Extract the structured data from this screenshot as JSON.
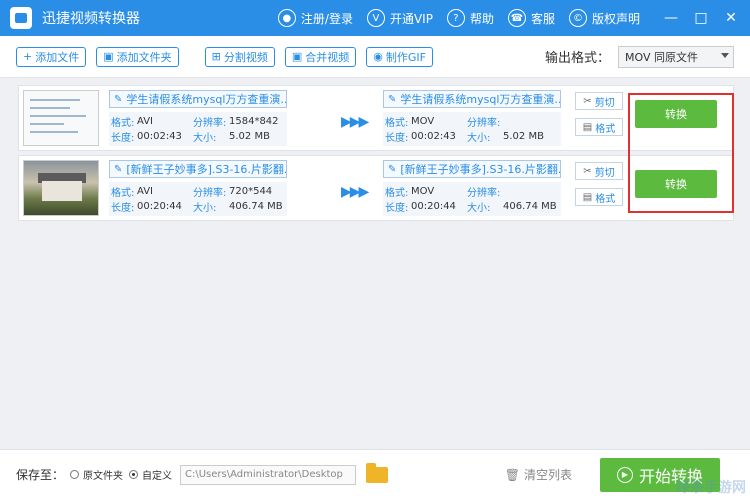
{
  "window": {
    "title": "迅捷视频转换器",
    "register_label": "注册/登录",
    "vip_label": "开通VIP",
    "help_label": "帮助",
    "service_label": "客服",
    "copyright_label": "版权声明"
  },
  "toolbar": {
    "add_file": "添加文件",
    "add_folder": "添加文件夹",
    "split_video": "分割视频",
    "merge_video": "合并视频",
    "make_gif": "制作GIF",
    "output_format_label": "输出格式：",
    "output_format_value": "MOV  同原文件"
  },
  "meta_labels": {
    "format": "格式:",
    "resolution": "分辨率:",
    "duration": "长度:",
    "size": "大小:"
  },
  "files": [
    {
      "src": {
        "name": "学生请假系统mysql万方查重演...",
        "format": "AVI",
        "resolution": "1584*842",
        "duration": "00:02:43",
        "size": "5.02 MB"
      },
      "dst": {
        "name": "学生请假系统mysql万方查重演...",
        "format": "MOV",
        "resolution": "",
        "duration": "00:02:43",
        "size": "5.02 MB"
      },
      "cut_label": "剪切",
      "format_label": "格式",
      "convert_label": "转换"
    },
    {
      "src": {
        "name": "[新鲜王子妙事多].S3-16.片影翻...",
        "format": "AVI",
        "resolution": "720*544",
        "duration": "00:20:44",
        "size": "406.74 MB"
      },
      "dst": {
        "name": "[新鲜王子妙事多].S3-16.片影翻...",
        "format": "MOV",
        "resolution": "",
        "duration": "00:20:44",
        "size": "406.74 MB"
      },
      "cut_label": "剪切",
      "format_label": "格式",
      "convert_label": "转换"
    }
  ],
  "bottom": {
    "save_to_label": "保存至：",
    "option_original": "原文件夹",
    "option_custom": "自定义",
    "path_value": "C:\\Users\\Administrator\\Desktop",
    "clear_label": "清空列表",
    "start_label": "开始转换"
  },
  "watermark": "绿茶手游网",
  "colors": {
    "accent": "#2a8ee6",
    "convert_green": "#5cbb3f",
    "highlight_red": "#e03030"
  }
}
